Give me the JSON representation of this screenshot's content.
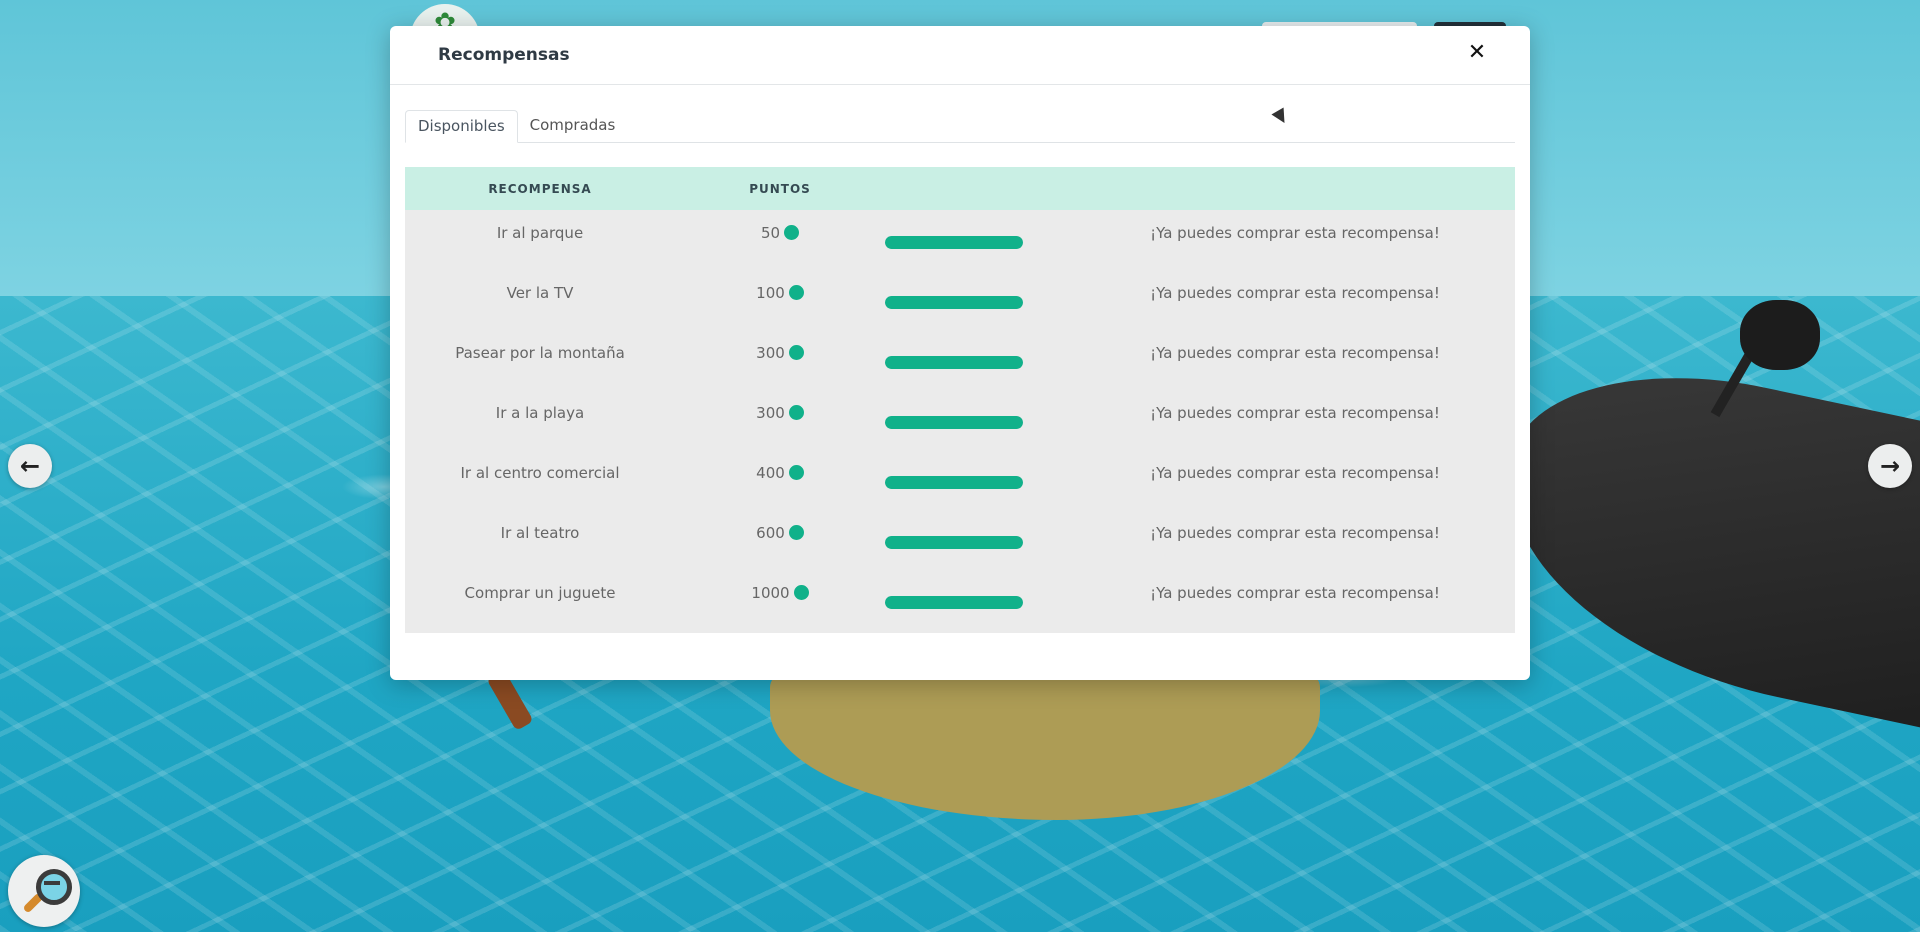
{
  "modal": {
    "title": "Recompensas",
    "close_icon": "close-icon"
  },
  "tabs": [
    {
      "label": "Disponibles",
      "active": true
    },
    {
      "label": "Compradas",
      "active": false
    }
  ],
  "table": {
    "headers": [
      "RECOMPENSA",
      "PUNTOS"
    ],
    "rows": [
      {
        "name": "Ir al parque",
        "points": "50",
        "progress": 1.0,
        "status": "¡Ya puedes comprar esta recompensa!"
      },
      {
        "name": "Ver la TV",
        "points": "100",
        "progress": 1.0,
        "status": "¡Ya puedes comprar esta recompensa!"
      },
      {
        "name": "Pasear por la montaña",
        "points": "300",
        "progress": 1.0,
        "status": "¡Ya puedes comprar esta recompensa!"
      },
      {
        "name": "Ir a la playa",
        "points": "300",
        "progress": 1.0,
        "status": "¡Ya puedes comprar esta recompensa!"
      },
      {
        "name": "Ir al centro comercial",
        "points": "400",
        "progress": 1.0,
        "status": "¡Ya puedes comprar esta recompensa!"
      },
      {
        "name": "Ir al teatro",
        "points": "600",
        "progress": 1.0,
        "status": "¡Ya puedes comprar esta recompensa!"
      },
      {
        "name": "Comprar un juguete",
        "points": "1000",
        "progress": 1.0,
        "status": "¡Ya puedes comprar esta recompensa!"
      }
    ]
  },
  "icons": {
    "coin": "coin-icon",
    "nav_left": "arrow-left-icon",
    "nav_right": "arrow-right-icon",
    "zoom": "zoom-out-icon"
  },
  "colors": {
    "accent": "#10b18a",
    "header_bg": "#c9efe4",
    "table_bg": "#ebebeb"
  }
}
